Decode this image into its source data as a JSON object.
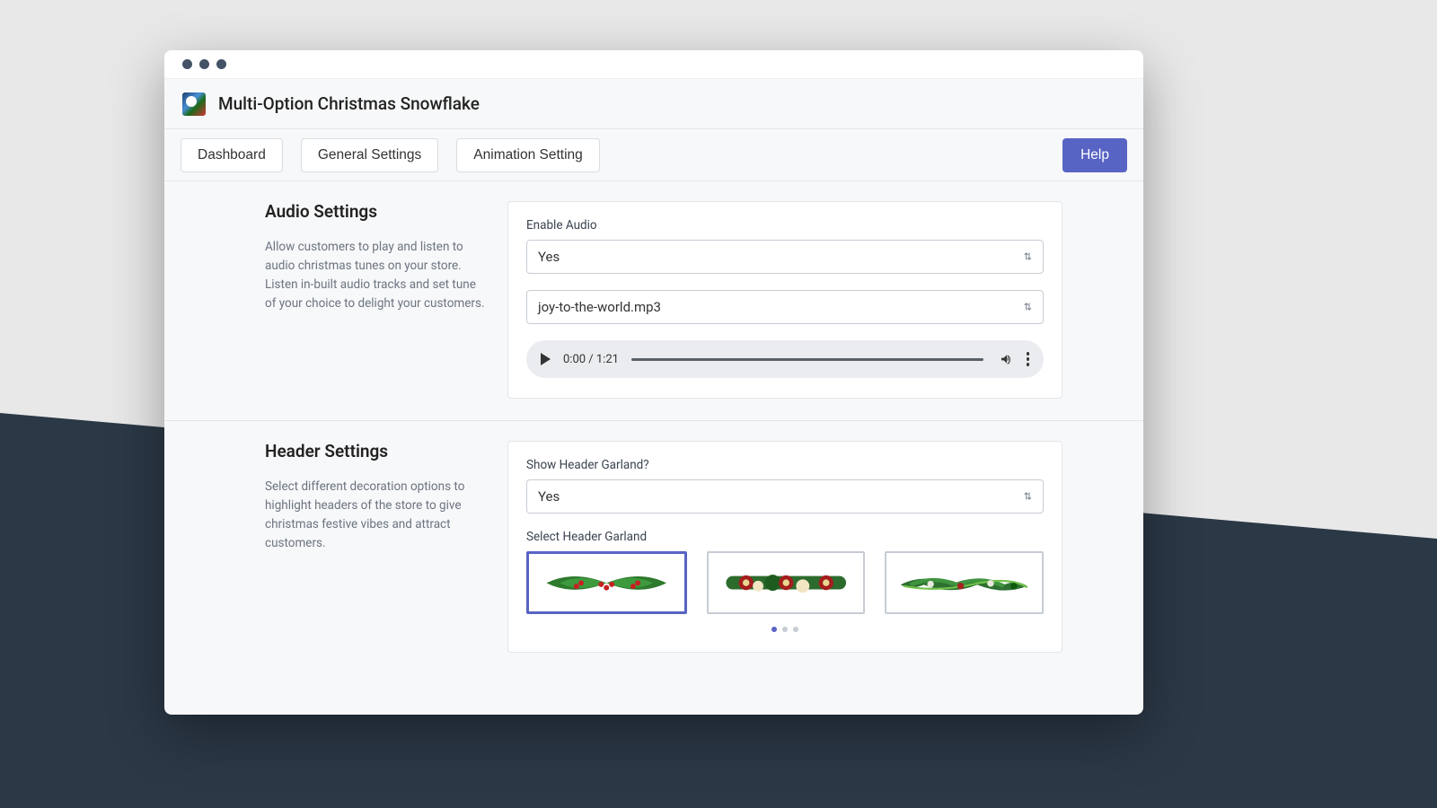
{
  "app": {
    "title": "Multi-Option Christmas Snowflake"
  },
  "nav": {
    "dashboard": "Dashboard",
    "general": "General Settings",
    "animation": "Animation Setting",
    "help": "Help"
  },
  "audio": {
    "title": "Audio Settings",
    "desc": "Allow customers to play and listen to audio christmas tunes on your store. Listen in-built audio tracks and set tune of your choice to delight your customers.",
    "enable_label": "Enable Audio",
    "enable_value": "Yes",
    "track_value": "joy-to-the-world.mp3",
    "player": {
      "time": "0:00 / 1:21"
    }
  },
  "header_section": {
    "title": "Header Settings",
    "desc": "Select different decoration options to highlight headers of the store to give christmas festive vibes and attract customers.",
    "show_label": "Show Header Garland?",
    "show_value": "Yes",
    "select_label": "Select Header Garland",
    "garlands": [
      "garland-holly",
      "garland-poinsettia",
      "garland-pine-swirl"
    ],
    "selected_index": 0,
    "page_dots": 3,
    "page_active": 0
  },
  "colors": {
    "accent": "#5864c3"
  }
}
